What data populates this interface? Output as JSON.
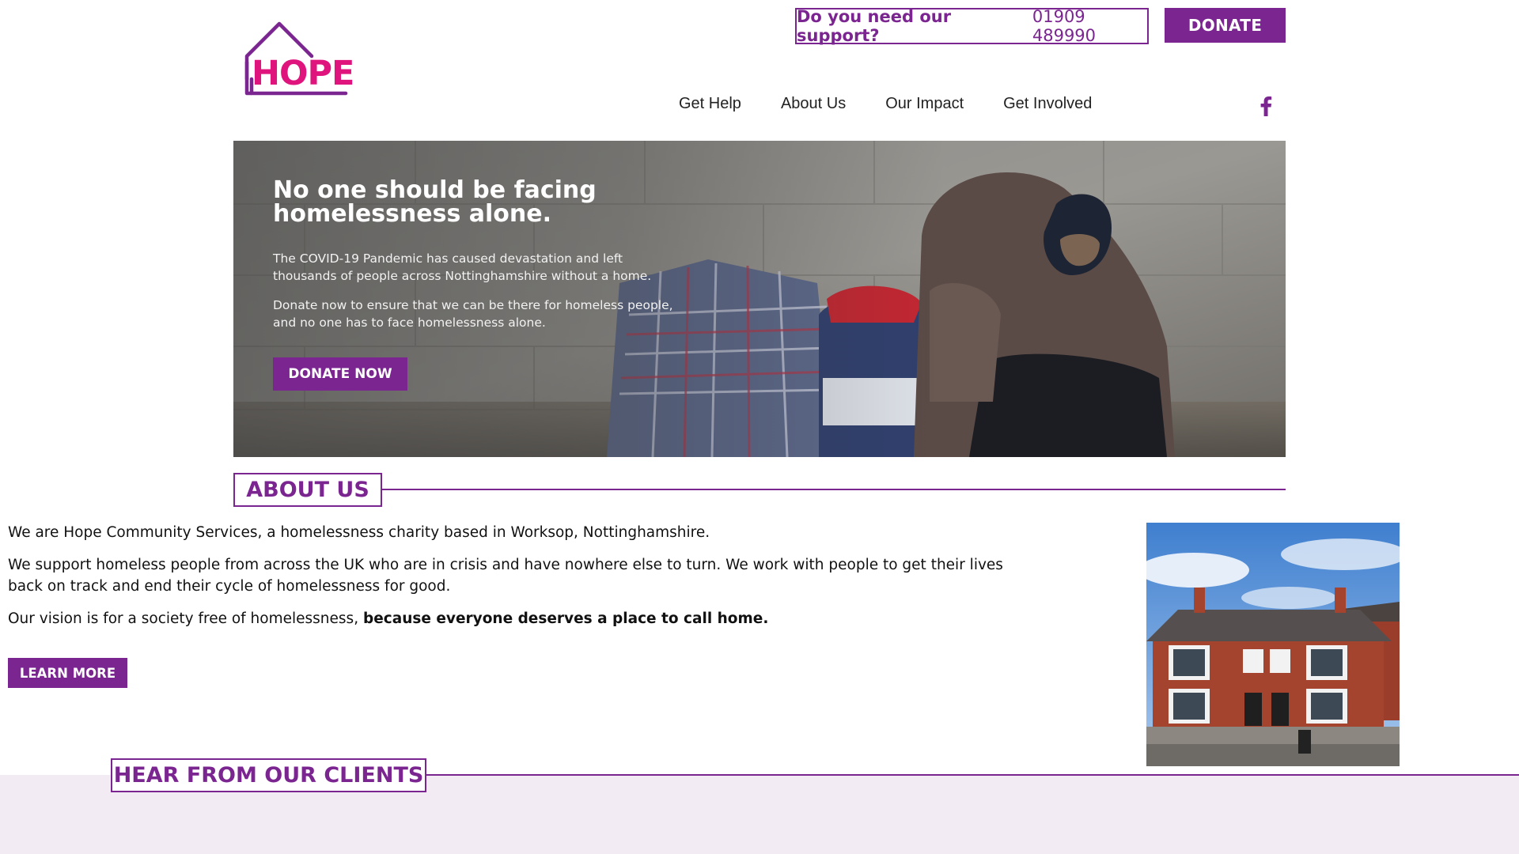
{
  "header": {
    "logo_text": "HOPE",
    "support_question": "Do you need our support?",
    "support_phone": "01909 489990",
    "donate_label": "DONATE",
    "nav": [
      "Get Help",
      "About Us",
      "Our Impact",
      "Get Involved"
    ],
    "social_icon": "facebook-icon"
  },
  "hero": {
    "title": "No one should be facing homelessness alone.",
    "para1": "The COVID-19 Pandemic has caused devastation and left thousands of people across Nottinghamshire without a home.",
    "para2": "Donate now to ensure that we can be there for homeless people, and no one has to face homelessness alone.",
    "button": "DONATE NOW"
  },
  "about": {
    "title": "ABOUT US",
    "p1": "We are Hope Community Services, a homelessness charity based in Worksop, Nottinghamshire.",
    "p2": "We support homeless people from across the UK who are in crisis and have nowhere else to turn. We work with people to get their lives back on track and end their cycle of homelessness for good.",
    "p3_plain": "Our vision is for a society free of homelessness, ",
    "p3_bold": "because everyone deserves a place to call home.",
    "button": "LEARN MORE"
  },
  "clients": {
    "title": "HEAR FROM OUR CLIENTS"
  },
  "colors": {
    "brand_purple": "#7b2591",
    "logo_pink": "#e0147d",
    "band_lilac": "#f2ebf4"
  }
}
